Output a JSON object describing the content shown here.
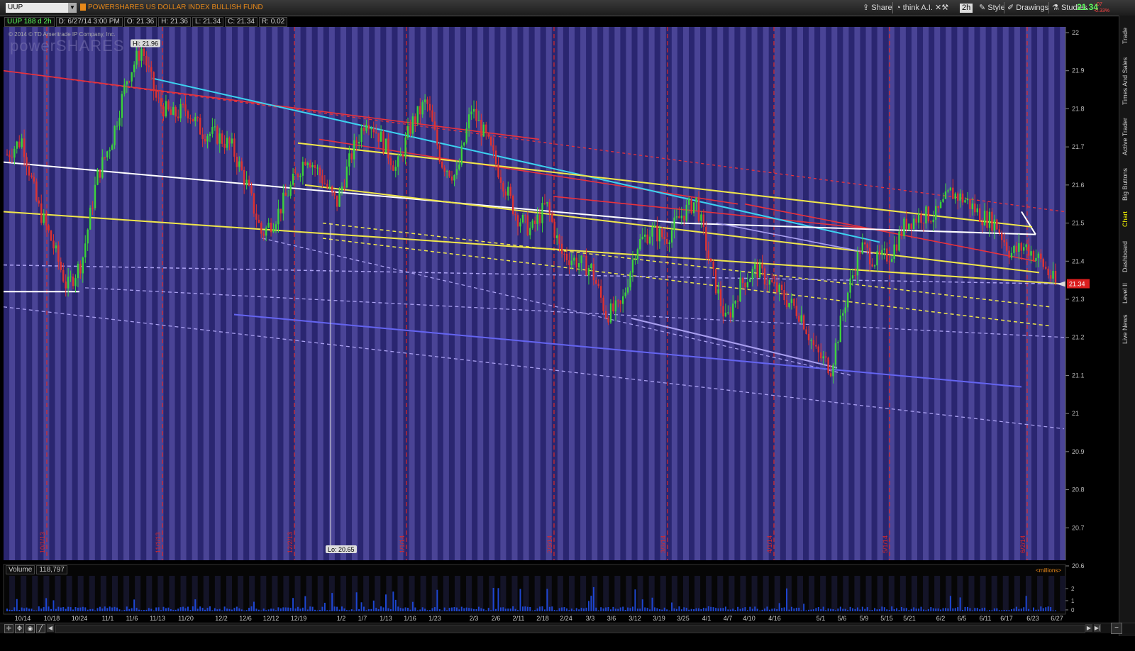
{
  "toolbar": {
    "symbol": "UUP",
    "fund_name": "POWERSHARES US DOLLAR INDEX BULLISH FUND",
    "share": "Share",
    "think": "think A.I.",
    "aggregation": "2h",
    "style": "Style",
    "drawings": "Drawings",
    "studies": "Studies",
    "last_price": "21.34",
    "change_1": "-.07",
    "change_2": "-0.33%"
  },
  "info": {
    "symbol_label": "UUP 188 d 2h",
    "date": "D: 6/27/14 3:00 PM",
    "open": "O: 21.36",
    "high": "H: 21.36",
    "low": "L: 21.34",
    "close": "C: 21.34",
    "range": "R: 0.02",
    "copyright": "© 2014 © TD Ameritrade IP Company, Inc.",
    "watermark": "powerSHARES"
  },
  "right_rail": {
    "tabs": [
      "Trade",
      "Times And Sales",
      "Active Trader",
      "Big Buttons",
      "Chart",
      "Dashboard",
      "Level II",
      "Live News"
    ],
    "active": "Chart"
  },
  "volume": {
    "label": "Volume",
    "value": "118,797",
    "units": "<millions>"
  },
  "colors": {
    "bg_band_a": "#2a2670",
    "bg_band_b": "#4a4496",
    "up": "#3cd23c",
    "down": "#dc3232",
    "white_line": "#ffffff",
    "yellow_line": "#f0e64a",
    "red_line": "#e8323c",
    "cyan_line": "#3cd2f0",
    "blue_line": "#6464f0",
    "lavender_line": "#aaa0f0",
    "price_tag": "#dc1e1e"
  },
  "chart_data": {
    "type": "candlestick",
    "interval": "2h",
    "ylim": [
      20.6,
      22.0
    ],
    "y_ticks": [
      22.0,
      21.9,
      21.8,
      21.7,
      21.6,
      21.5,
      21.4,
      21.3,
      21.2,
      21.1,
      21.0,
      20.9,
      20.8,
      20.7,
      20.6
    ],
    "x_tick_labels": [
      "10/14",
      "10/18",
      "10/24",
      "11/1",
      "11/6",
      "11/13",
      "11/20",
      "12/2",
      "12/6",
      "12/12",
      "12/19",
      "1/2",
      "1/7",
      "1/13",
      "1/16",
      "1/23",
      "2/3",
      "2/6",
      "2/11",
      "2/18",
      "2/24",
      "3/3",
      "3/6",
      "3/12",
      "3/19",
      "3/25",
      "4/1",
      "4/7",
      "4/10",
      "4/16",
      "5/1",
      "5/6",
      "5/9",
      "5/15",
      "5/21",
      "6/2",
      "6/5",
      "6/11",
      "6/17",
      "6/23",
      "6/27"
    ],
    "month_markers": [
      "10/1/13",
      "11/1/13",
      "12/2/13",
      "1/1/14",
      "2/3/14",
      "3/3/14",
      "4/1/14",
      "5/1/14",
      "6/2/14"
    ],
    "annotations": {
      "high_label": "Hi: 21.96",
      "low_label": "Lo: 20.65",
      "current_price_label": "21.34"
    },
    "price_path": [
      [
        "10/14",
        21.68
      ],
      [
        "10/15",
        21.72
      ],
      [
        "10/18",
        21.55
      ],
      [
        "10/21",
        21.45
      ],
      [
        "10/24",
        21.33
      ],
      [
        "10/28",
        21.4
      ],
      [
        "11/1",
        21.62
      ],
      [
        "11/4",
        21.72
      ],
      [
        "11/6",
        21.88
      ],
      [
        "11/8",
        21.96
      ],
      [
        "11/11",
        21.82
      ],
      [
        "11/13",
        21.78
      ],
      [
        "11/18",
        21.8
      ],
      [
        "11/20",
        21.74
      ],
      [
        "11/25",
        21.73
      ],
      [
        "12/2",
        21.7
      ],
      [
        "12/6",
        21.6
      ],
      [
        "12/9",
        21.47
      ],
      [
        "12/12",
        21.52
      ],
      [
        "12/17",
        21.6
      ],
      [
        "12/19",
        21.68
      ],
      [
        "12/23",
        21.62
      ],
      [
        "12/30",
        21.55
      ],
      [
        "1/2",
        21.68
      ],
      [
        "1/7",
        21.78
      ],
      [
        "1/10",
        21.72
      ],
      [
        "1/13",
        21.64
      ],
      [
        "1/16",
        21.76
      ],
      [
        "1/21",
        21.82
      ],
      [
        "1/23",
        21.66
      ],
      [
        "1/28",
        21.62
      ],
      [
        "2/3",
        21.8
      ],
      [
        "2/6",
        21.72
      ],
      [
        "2/11",
        21.62
      ],
      [
        "2/14",
        21.52
      ],
      [
        "2/18",
        21.48
      ],
      [
        "2/24",
        21.55
      ],
      [
        "2/28",
        21.42
      ],
      [
        "3/3",
        21.4
      ],
      [
        "3/6",
        21.38
      ],
      [
        "3/12",
        21.26
      ],
      [
        "3/14",
        21.28
      ],
      [
        "3/19",
        21.44
      ],
      [
        "3/21",
        21.48
      ],
      [
        "3/25",
        21.46
      ],
      [
        "4/1",
        21.52
      ],
      [
        "4/4",
        21.56
      ],
      [
        "4/7",
        21.38
      ],
      [
        "4/10",
        21.24
      ],
      [
        "4/14",
        21.34
      ],
      [
        "4/16",
        21.38
      ],
      [
        "4/22",
        21.34
      ],
      [
        "4/25",
        21.3
      ],
      [
        "5/1",
        21.26
      ],
      [
        "5/5",
        21.16
      ],
      [
        "5/6",
        21.12
      ],
      [
        "5/9",
        21.3
      ],
      [
        "5/13",
        21.44
      ],
      [
        "5/15",
        21.4
      ],
      [
        "5/19",
        21.42
      ],
      [
        "5/21",
        21.5
      ],
      [
        "5/27",
        21.52
      ],
      [
        "6/2",
        21.52
      ],
      [
        "6/5",
        21.58
      ],
      [
        "6/9",
        21.56
      ],
      [
        "6/11",
        21.52
      ],
      [
        "6/17",
        21.5
      ],
      [
        "6/20",
        21.42
      ],
      [
        "6/23",
        21.44
      ],
      [
        "6/26",
        21.4
      ],
      [
        "6/27",
        21.34
      ]
    ]
  }
}
